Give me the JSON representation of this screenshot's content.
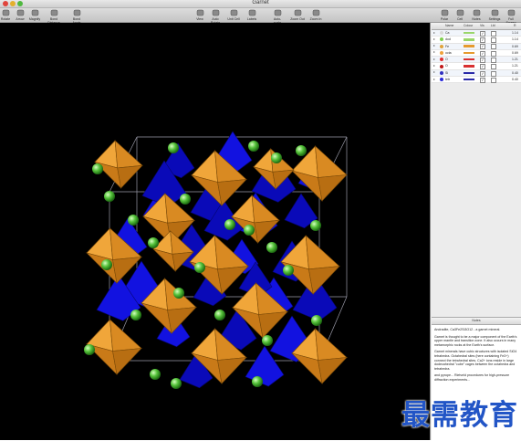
{
  "window": {
    "title": "Garnet"
  },
  "toolbar": {
    "buttons": [
      {
        "label": "Rotate",
        "icon": "rotate-icon"
      },
      {
        "label": "Arrow",
        "icon": "arrow-icon"
      },
      {
        "label": "Magnify",
        "icon": "magnify-icon"
      },
      {
        "label": "Bond Distance",
        "icon": "bond-distance-icon"
      },
      {
        "label": "Bond Angle",
        "icon": "bond-angle-icon"
      },
      {
        "label": "View",
        "icon": "view-icon"
      },
      {
        "label": "Auto Rotate",
        "icon": "auto-rotate-icon"
      },
      {
        "label": "Unit Cell",
        "icon": "unit-cell-icon"
      },
      {
        "label": "Labels",
        "icon": "labels-icon"
      },
      {
        "label": "Auto-scale",
        "icon": "auto-scale-icon"
      },
      {
        "label": "Zoom Out",
        "icon": "zoom-out-icon"
      },
      {
        "label": "Zoom In",
        "icon": "zoom-in-icon"
      },
      {
        "label": "Polar",
        "icon": "polar-icon"
      },
      {
        "label": "Cell",
        "icon": "cell-icon"
      },
      {
        "label": "Notes",
        "icon": "notes-icon"
      },
      {
        "label": "Settings",
        "icon": "settings-icon"
      },
      {
        "label": "Full Screen",
        "icon": "full-screen-icon"
      }
    ]
  },
  "atoms_table": {
    "headers": [
      "Name",
      "Colour",
      "Vis",
      "Lbl",
      "R"
    ],
    "rows": [
      {
        "name": "Ca",
        "radius": "1.14",
        "color": "#d9d9d9",
        "swatch": "#9ad66a",
        "vis": "✓",
        "lbl": ""
      },
      {
        "name": "dod",
        "radius": "1.14",
        "color": "#7fcf4e",
        "swatch": "#9ad66a",
        "vis": "✓",
        "lbl": ""
      },
      {
        "name": "Fe",
        "radius": "0.69",
        "color": "#e0a33a",
        "swatch": "#e69a2e",
        "vis": "✓",
        "lbl": ""
      },
      {
        "name": "octa",
        "radius": "0.69",
        "color": "#f0a23a",
        "swatch": "#e69a2e",
        "vis": "✓",
        "lbl": ""
      },
      {
        "name": "O",
        "radius": "1.21",
        "color": "#e03030",
        "swatch": "#d83030",
        "vis": "✓",
        "lbl": ""
      },
      {
        "name": "O",
        "radius": "1.21",
        "color": "#c01818",
        "swatch": "#d83030",
        "vis": "✓",
        "lbl": ""
      },
      {
        "name": "Si",
        "radius": "0.40",
        "color": "#3030c0",
        "swatch": "#2a2aa8",
        "vis": "✓",
        "lbl": ""
      },
      {
        "name": "tetr",
        "radius": "0.40",
        "color": "#2a2ad8",
        "swatch": "#2a2aa8",
        "vis": "✓",
        "lbl": ""
      }
    ]
  },
  "notes": {
    "header": "Notes",
    "paragraphs": [
      "Andradite, Ca3Fe2Si3O12 - a garnet mineral.",
      "Garnet is thought to be a major component of the Earth's upper mantle and transition zone. It also occurs in many metamorphic rocks at the Earth's surface.",
      "Garnet minerals have cubic structures with isolated SiO4 tetrahedra. Octahedral sites (here containing Fe3+) connect the tetrahedral sites. Ca2+ ions reside in large dodecahedral \"cube\" cages between the octahedra and tetrahedra.",
      "and pyrope... Rietveld procedures for high-pressure diffraction experiments..."
    ]
  },
  "watermark": {
    "text": "最需教育"
  }
}
